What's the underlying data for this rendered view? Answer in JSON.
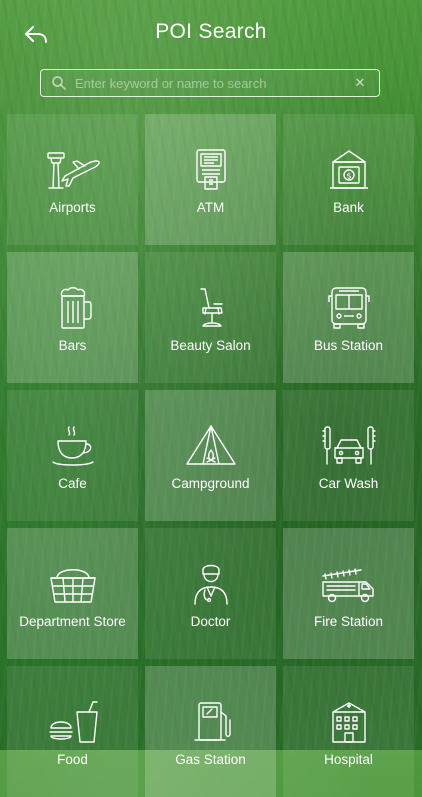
{
  "header": {
    "title": "POI Search",
    "back_icon": "back-arrow-icon"
  },
  "search": {
    "placeholder": "Enter keyword or name to search",
    "value": "",
    "search_icon": "magnifier-icon",
    "clear_icon": "clear-x-icon",
    "clear_glyph": "✕"
  },
  "categories": [
    {
      "label": "Airports",
      "icon": "airport-icon"
    },
    {
      "label": "ATM",
      "icon": "atm-icon"
    },
    {
      "label": "Bank",
      "icon": "bank-icon"
    },
    {
      "label": "Bars",
      "icon": "beer-mug-icon"
    },
    {
      "label": "Beauty Salon",
      "icon": "salon-chair-icon"
    },
    {
      "label": "Bus Station",
      "icon": "bus-icon"
    },
    {
      "label": "Cafe",
      "icon": "coffee-cup-icon"
    },
    {
      "label": "Campground",
      "icon": "tent-icon"
    },
    {
      "label": "Car Wash",
      "icon": "car-wash-icon"
    },
    {
      "label": "Department Store",
      "icon": "shopping-basket-icon"
    },
    {
      "label": "Doctor",
      "icon": "doctor-icon"
    },
    {
      "label": "Fire Station",
      "icon": "fire-truck-icon"
    },
    {
      "label": "Food",
      "icon": "fast-food-icon"
    },
    {
      "label": "Gas Station",
      "icon": "gas-pump-icon"
    },
    {
      "label": "Hospital",
      "icon": "hospital-icon"
    }
  ],
  "colors": {
    "background": "#3f8a33",
    "text": "#ffffff"
  }
}
